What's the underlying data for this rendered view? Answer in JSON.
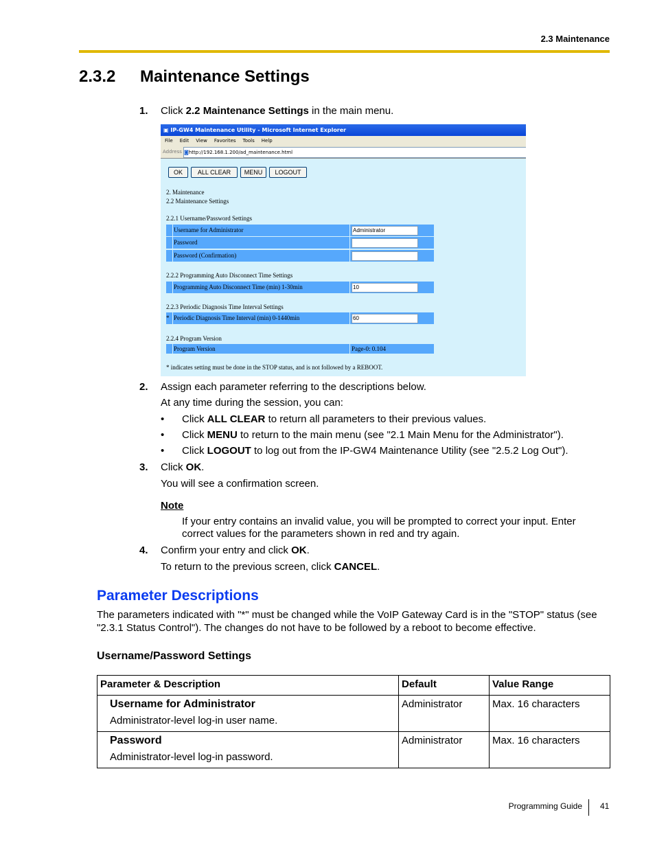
{
  "header": {
    "section": "2.3 Maintenance",
    "rule_color": "#e0b800"
  },
  "heading": {
    "number": "2.3.2",
    "title": "Maintenance Settings"
  },
  "steps": [
    {
      "num": "1.",
      "pre": "Click ",
      "bold": "2.2 Maintenance Settings",
      "post": " in the main menu."
    },
    {
      "num": "2.",
      "text": "Assign each parameter referring to the descriptions below.",
      "sub": "At any time during the session, you can:",
      "bullets": [
        {
          "pre": "Click ",
          "bold": "ALL CLEAR",
          "post": " to return all parameters to their previous values."
        },
        {
          "pre": "Click ",
          "bold": "MENU",
          "post": " to return to the main menu (see \"2.1 Main Menu for the Administrator\")."
        },
        {
          "pre": "Click ",
          "bold": "LOGOUT",
          "post": " to log out from the IP-GW4 Maintenance Utility (see \"2.5.2 Log Out\")."
        }
      ]
    },
    {
      "num": "3.",
      "pre": "Click ",
      "bold": "OK",
      "post": ".",
      "sub": "You will see a confirmation screen."
    },
    {
      "num": "4.",
      "pre": "Confirm your entry and click ",
      "bold": "OK",
      "post": ".",
      "sub_pre": "To return to the previous screen, click ",
      "sub_bold": "CANCEL",
      "sub_post": "."
    }
  ],
  "note": {
    "label": "Note",
    "line1": "If your entry contains an invalid value, you will be prompted to correct your input. Enter",
    "line2": "correct values for the parameters shown in red and try again."
  },
  "screenshot": {
    "title": "IP-GW4 Maintenance Utility - Microsoft Internet Explorer",
    "menu": [
      "File",
      "Edit",
      "View",
      "Favorites",
      "Tools",
      "Help"
    ],
    "address_label": "Address",
    "url": "http://192.168.1.200/ad_maintenance.html",
    "buttons": [
      "OK",
      "ALL CLEAR",
      "MENU",
      "LOGOUT"
    ],
    "breadcrumb1": "2. Maintenance",
    "breadcrumb2": "2.2 Maintenance Settings",
    "s1": "2.2.1 Username/Password Settings",
    "r_user": "Username for Administrator",
    "r_user_val": "Administrator",
    "r_pass": "Password",
    "r_pass2": "Password (Confirmation)",
    "s2": "2.2.2 Programming Auto Disconnect Time Settings",
    "r_auto": "Programming Auto Disconnect Time (min) 1-30min",
    "r_auto_val": "10",
    "s3": "2.2.3 Periodic Diagnosis Time Interval Settings",
    "r_diag_mark": "*",
    "r_diag": "Periodic Diagnosis Time Interval (min) 0-1440min",
    "r_diag_val": "60",
    "s4": "2.2.4 Program Version",
    "r_ver": "Program Version",
    "r_ver_val": "Page-0: 0.104",
    "footnote": "* indicates setting must be done in the STOP status, and is not followed by a REBOOT."
  },
  "param": {
    "title": "Parameter Descriptions",
    "title_color": "#0a3cf0",
    "intro1": "The parameters indicated with \"*\" must be changed while the VoIP Gateway Card is in the \"STOP\" status (see",
    "intro2": "\"2.3.1 Status Control\"). The changes do not have to be followed by a reboot to become effective.",
    "subhead": "Username/Password Settings",
    "table": {
      "headers": [
        "Parameter & Description",
        "Default",
        "Value Range"
      ],
      "rows": [
        {
          "name": "Username for Administrator",
          "desc": "Administrator-level log-in user name.",
          "default": "Administrator",
          "range": "Max. 16 characters"
        },
        {
          "name": "Password",
          "desc": "Administrator-level log-in password.",
          "default": "Administrator",
          "range": "Max. 16 characters"
        }
      ]
    }
  },
  "footer": {
    "guide": "Programming Guide",
    "page": "41"
  }
}
